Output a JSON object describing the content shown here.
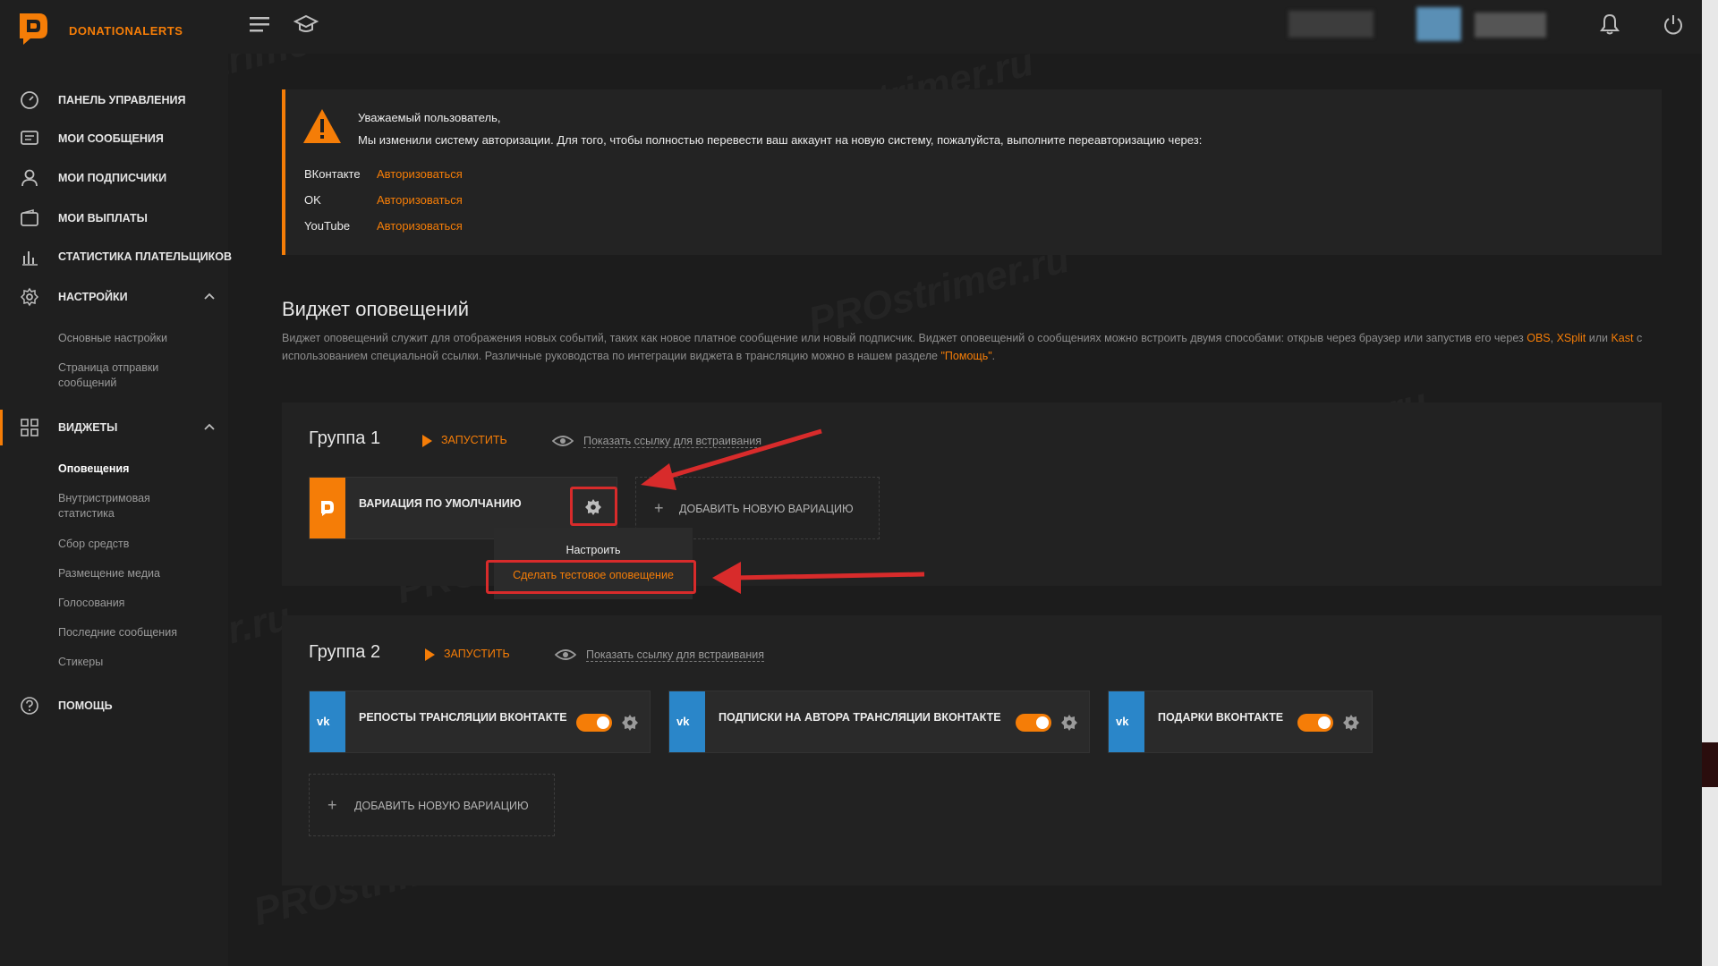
{
  "app": {
    "brand": "DONATIONALERTS",
    "accent_color": "#f57d07",
    "vk_color": "#2a86c9"
  },
  "sidebar": {
    "items": [
      {
        "label": "ПАНЕЛЬ УПРАВЛЕНИЯ",
        "icon": "dashboard-icon"
      },
      {
        "label": "МОИ СООБЩЕНИЯ",
        "icon": "messages-icon"
      },
      {
        "label": "МОИ ПОДПИСЧИКИ",
        "icon": "user-icon"
      },
      {
        "label": "МОИ ВЫПЛАТЫ",
        "icon": "wallet-icon"
      },
      {
        "label": "СТАТИСТИКА ПЛАТЕЛЬЩИКОВ",
        "icon": "bar-chart-icon"
      },
      {
        "label": "НАСТРОЙКИ",
        "icon": "gear-icon"
      },
      {
        "label": "ВИДЖЕТЫ",
        "icon": "grid-icon"
      },
      {
        "label": "ПОМОЩЬ",
        "icon": "help-icon"
      }
    ],
    "settings_sub": [
      "Основные настройки",
      "Страница отправки сообщений"
    ],
    "widgets_sub": [
      "Оповещения",
      "Внутристримовая статистика",
      "Сбор средств",
      "Размещение медиа",
      "Голосования",
      "Последние сообщения",
      "Стикеры"
    ]
  },
  "notice": {
    "title": "Уважаемый пользователь,",
    "text": "Мы изменили систему авторизации. Для того, чтобы полностью перевести ваш аккаунт на новую систему, пожалуйста, выполните переавторизацию через:",
    "networks": [
      {
        "name": "ВКонтакте",
        "action": "Авторизоваться"
      },
      {
        "name": "OK",
        "action": "Авторизоваться"
      },
      {
        "name": "YouTube",
        "action": "Авторизоваться"
      }
    ]
  },
  "section": {
    "title": "Виджет оповещений",
    "desc_1": "Виджет оповещений служит для отображения новых событий, таких как новое платное сообщение или новый подписчик. Виджет оповещений о сообщениях можно встроить двумя способами: открыв через браузер или запустив его через ",
    "desc_obs": "OBS",
    "desc_comma": ",",
    "desc_xsplit": "XSplit",
    "desc_or": " или ",
    "desc_kast": "Kast",
    "desc_2": " с использованием специальной ссылки. Различные руководства по интеграции виджета в трансляцию можно в нашем разделе ",
    "desc_help": "\"Помощь\"",
    "desc_end": "."
  },
  "groups": [
    {
      "title": "Группа 1",
      "run": "ЗАПУСТИТЬ",
      "embed": "Показать ссылку для встраивания",
      "cards": [
        {
          "title": "ВАРИАЦИЯ ПО УМОЛЧАНИЮ"
        }
      ],
      "add": "ДОБАВИТЬ НОВУЮ ВАРИАЦИЮ"
    },
    {
      "title": "Группа 2",
      "run": "ЗАПУСТИТЬ",
      "embed": "Показать ссылку для встраивания",
      "cards": [
        {
          "title": "РЕПОСТЫ ТРАНСЛЯЦИИ ВКОНТАКТЕ",
          "enabled": true
        },
        {
          "title": "ПОДПИСКИ НА АВТОРА ТРАНСЛЯЦИИ ВКОНТАКТЕ",
          "enabled": true
        },
        {
          "title": "ПОДАРКИ ВКОНТАКТЕ",
          "enabled": true
        }
      ],
      "add": "ДОБАВИТЬ НОВУЮ ВАРИАЦИЮ"
    }
  ],
  "dropdown": {
    "configure": "Настроить",
    "test_alert": "Сделать тестовое оповещение"
  },
  "watermark": "PROstrimer.ru"
}
